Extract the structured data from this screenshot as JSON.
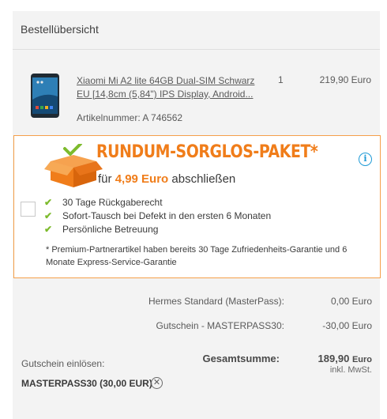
{
  "order_summary": {
    "heading": "Bestellübersicht"
  },
  "product": {
    "name": "Xiaomi Mi A2 lite 64GB Dual-SIM Schwarz EU [14,8cm (5,84\") IPS Display, Android...",
    "quantity": "1",
    "price": "219,90 Euro",
    "article_number": "Artikelnummer: A 746562",
    "image_icon": "smartphone-image"
  },
  "promo": {
    "title": "RUNDUM-SORGLOS-PAKET*",
    "subtitle_prefix": "für ",
    "subtitle_price": "4,99 Euro",
    "subtitle_suffix": " abschließen",
    "info_icon": "info-icon",
    "box_icon": "package-check-icon",
    "benefits": [
      "30 Tage Rückgaberecht",
      "Sofort-Tausch bei Defekt in den ersten 6 Monaten",
      "Persönliche Betreuung"
    ],
    "footnote": "* Premium-Partnerartikel haben bereits 30 Tage Zufriedenheits-Garantie und 6 Monate Express-Service-Garantie",
    "accent_color": "#f07d1a",
    "check_color": "#7dbb2d",
    "checked": false
  },
  "summary": {
    "shipping_label": "Hermes Standard (MasterPass):",
    "shipping_value": "0,00 Euro",
    "voucher_label": "Gutschein - MASTERPASS30:",
    "voucher_value": "-30,00 Euro",
    "total_label": "Gesamtsumme:",
    "total_value": "189,90",
    "total_currency": "Euro",
    "vat_note": "inkl. MwSt."
  },
  "coupon": {
    "label": "Gutschein einlösen:",
    "code": "MASTERPASS30 (30,00 EUR)",
    "remove_icon": "close-circle-icon"
  }
}
